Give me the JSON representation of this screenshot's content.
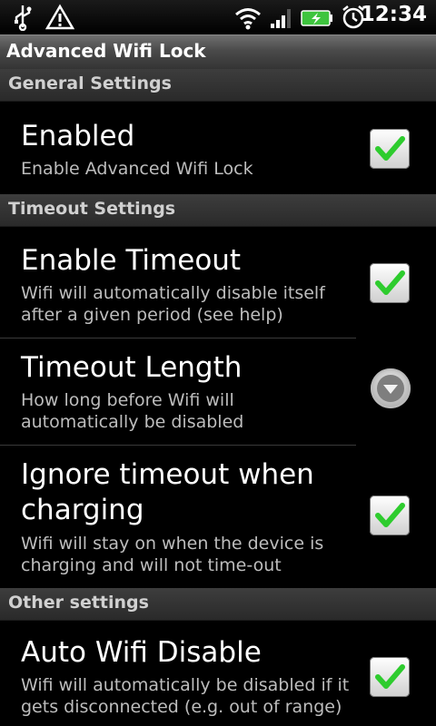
{
  "status_bar": {
    "time": "12:34",
    "icons": [
      "usb-icon",
      "warning-icon",
      "wifi-icon",
      "signal-icon",
      "battery-charging-icon",
      "alarm-icon"
    ]
  },
  "title_bar": {
    "title": "Advanced Wifi Lock"
  },
  "sections": {
    "general": {
      "label": "General Settings",
      "enabled": {
        "title": "Enabled",
        "summary": "Enable Advanced Wifi Lock",
        "checked": true
      }
    },
    "timeout": {
      "label": "Timeout Settings",
      "enable_timeout": {
        "title": "Enable Timeout",
        "summary": "Wifi will automatically disable itself after a given period (see help)",
        "checked": true
      },
      "timeout_length": {
        "title": "Timeout Length",
        "summary": "How long before Wifi will automatically be disabled"
      },
      "ignore_charging": {
        "title": "Ignore timeout when charging",
        "summary": "Wifi will stay on when the device is charging and will not time-out",
        "checked": true
      }
    },
    "other": {
      "label": "Other settings",
      "auto_disable": {
        "title": "Auto Wifi Disable",
        "summary": "Wifi will automatically be disabled if it gets disconnected (e.g. out of range)",
        "checked": true
      }
    }
  },
  "colors": {
    "check_green": "#2ecc2e",
    "checkbox_bg": "#e6e6e6",
    "summary_text": "#bdbdbd"
  }
}
